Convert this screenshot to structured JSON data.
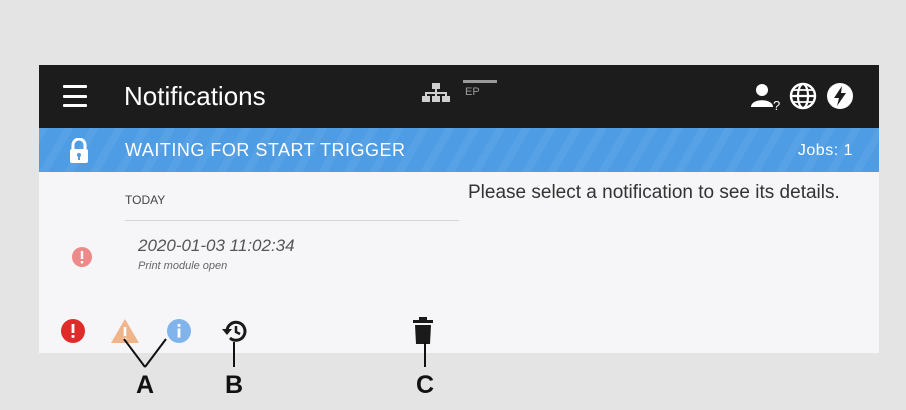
{
  "header": {
    "title": "Notifications",
    "ep_label": "EP"
  },
  "status": {
    "text": "WAITING FOR START TRIGGER",
    "jobs": "Jobs: 1"
  },
  "notifications": {
    "day_header": "TODAY",
    "items": [
      {
        "timestamp": "2020-01-03 11:02:34",
        "message": "Print module open",
        "severity": "error"
      }
    ]
  },
  "detail": {
    "placeholder": "Please select a notification to see its details."
  },
  "callouts": {
    "a": "A",
    "b": "B",
    "c": "C"
  },
  "colors": {
    "topbar": "#1c1c1c",
    "statusbar": "#4d9ce4",
    "error": "#e12a2a",
    "error_faded": "#ec8a8a",
    "warning_faded": "#f0b48a",
    "info_faded": "#80b4ea",
    "icon_dark": "#1a1a1a"
  },
  "icons": {
    "menu": "hamburger-icon",
    "network": "network-icon",
    "user": "user-help-icon",
    "globe": "globe-icon",
    "power": "power-icon",
    "lock": "lock-icon",
    "history": "history-icon",
    "delete": "trash-icon"
  }
}
